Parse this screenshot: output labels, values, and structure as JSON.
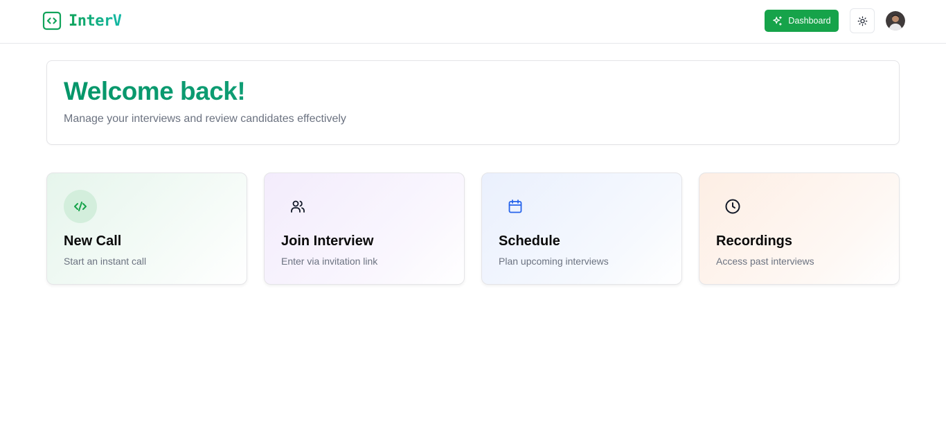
{
  "header": {
    "brand": "InterV",
    "dashboard_label": "Dashboard"
  },
  "welcome": {
    "title": "Welcome back!",
    "subtitle": "Manage your interviews and review candidates effectively"
  },
  "actions": [
    {
      "title": "New Call",
      "description": "Start an instant call",
      "icon": "code-icon",
      "color": "#16a34a"
    },
    {
      "title": "Join Interview",
      "description": "Enter via invitation link",
      "icon": "users-icon",
      "color": "#111827"
    },
    {
      "title": "Schedule",
      "description": "Plan upcoming interviews",
      "icon": "calendar-icon",
      "color": "#2563eb"
    },
    {
      "title": "Recordings",
      "description": "Access past interviews",
      "icon": "clock-icon",
      "color": "#111827"
    }
  ],
  "colors": {
    "accent": "#16a34a",
    "brand_gradient_start": "#10a35a",
    "brand_gradient_end": "#14b8a6",
    "muted_text": "#6b7280",
    "border": "#e4e4e7"
  }
}
